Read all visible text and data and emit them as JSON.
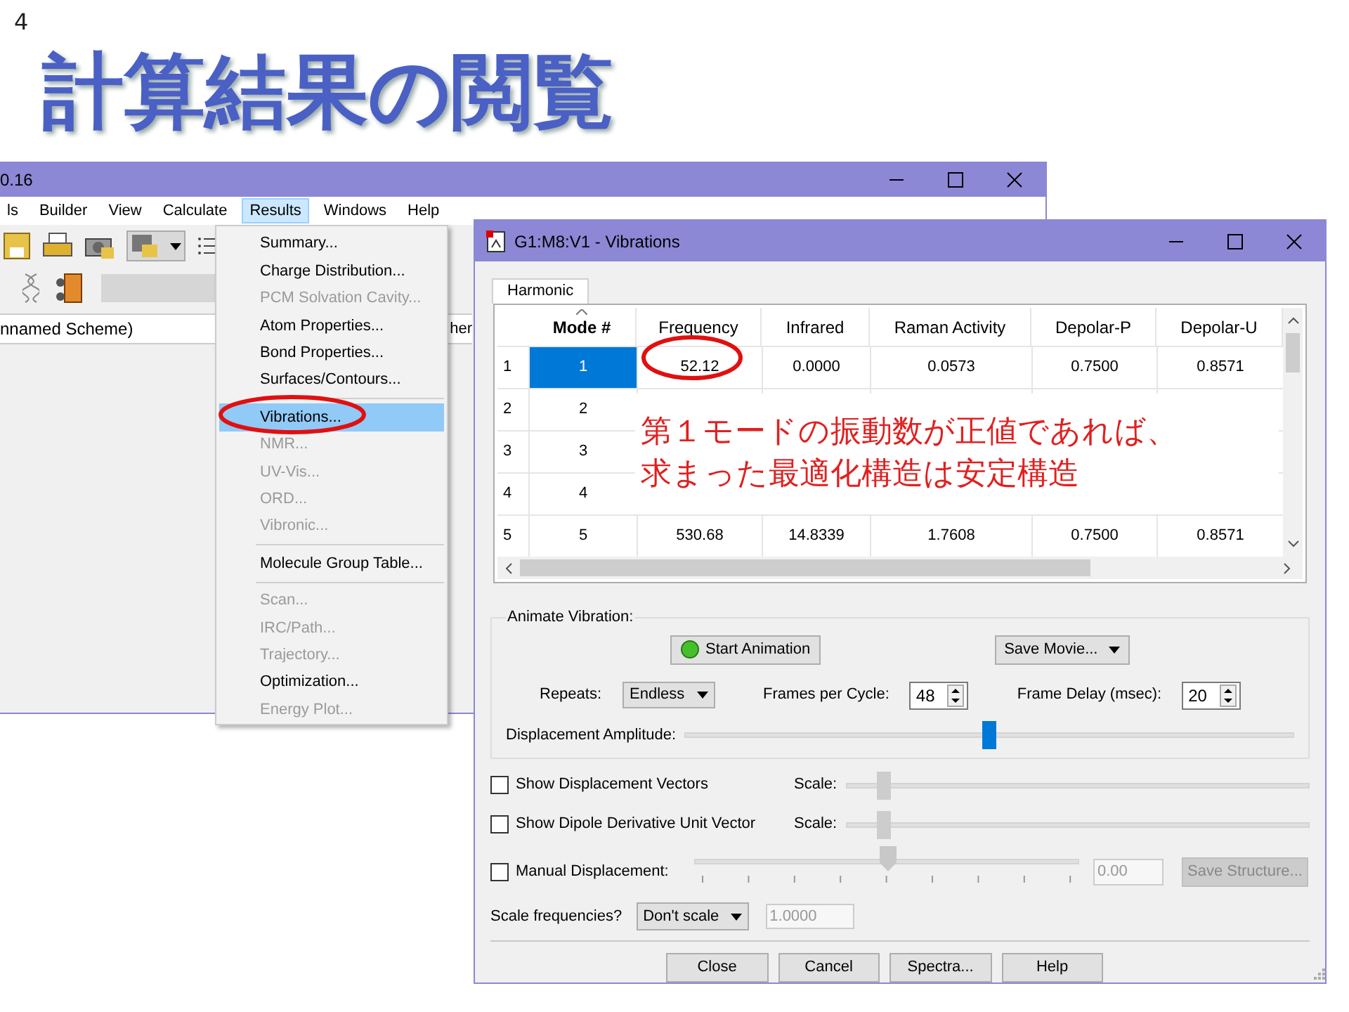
{
  "slide": {
    "page_number": "4",
    "title": "計算結果の閲覧"
  },
  "main_window": {
    "title": "0.16",
    "menu": [
      {
        "label": "ls",
        "selected": false
      },
      {
        "label": "Builder",
        "selected": false
      },
      {
        "label": "View",
        "selected": false
      },
      {
        "label": "Calculate",
        "selected": false
      },
      {
        "label": "Results",
        "selected": true
      },
      {
        "label": "Windows",
        "selected": false
      },
      {
        "label": "Help",
        "selected": false
      }
    ],
    "scheme_label": "nnamed Scheme)",
    "peek_text": "her"
  },
  "results_menu": [
    {
      "label": "Summary...",
      "disabled": false,
      "selected": false,
      "separator_before": false
    },
    {
      "label": "Charge Distribution...",
      "disabled": false,
      "selected": false,
      "separator_before": false
    },
    {
      "label": "PCM Solvation Cavity...",
      "disabled": true,
      "selected": false,
      "separator_before": false
    },
    {
      "label": "Atom Properties...",
      "disabled": false,
      "selected": false,
      "separator_before": false
    },
    {
      "label": "Bond Properties...",
      "disabled": false,
      "selected": false,
      "separator_before": false
    },
    {
      "label": "Surfaces/Contours...",
      "disabled": false,
      "selected": false,
      "separator_before": false
    },
    {
      "label": "Vibrations...",
      "disabled": false,
      "selected": true,
      "separator_before": true
    },
    {
      "label": "NMR...",
      "disabled": true,
      "selected": false,
      "separator_before": false
    },
    {
      "label": "UV-Vis...",
      "disabled": true,
      "selected": false,
      "separator_before": false
    },
    {
      "label": "ORD...",
      "disabled": true,
      "selected": false,
      "separator_before": false
    },
    {
      "label": "Vibronic...",
      "disabled": true,
      "selected": false,
      "separator_before": false
    },
    {
      "label": "Molecule Group Table...",
      "disabled": false,
      "selected": false,
      "separator_before": true
    },
    {
      "label": "Scan...",
      "disabled": true,
      "selected": false,
      "separator_before": true
    },
    {
      "label": "IRC/Path...",
      "disabled": true,
      "selected": false,
      "separator_before": false
    },
    {
      "label": "Trajectory...",
      "disabled": true,
      "selected": false,
      "separator_before": false
    },
    {
      "label": "Optimization...",
      "disabled": false,
      "selected": false,
      "separator_before": false
    },
    {
      "label": "Energy Plot...",
      "disabled": true,
      "selected": false,
      "separator_before": false
    }
  ],
  "dialog": {
    "title": "G1:M8:V1 - Vibrations",
    "tabs": [
      {
        "label": "Harmonic",
        "selected": true
      }
    ],
    "table": {
      "columns": [
        "Mode #",
        "Frequency",
        "Infrared",
        "Raman Activity",
        "Depolar-P",
        "Depolar-U"
      ],
      "rows": [
        {
          "header": "1",
          "selected": true,
          "cells": [
            "1",
            "52.12",
            "0.0000",
            "0.0573",
            "0.7500",
            "0.8571"
          ]
        },
        {
          "header": "2",
          "selected": false,
          "cells": [
            "2"
          ]
        },
        {
          "header": "3",
          "selected": false,
          "cells": [
            "3"
          ]
        },
        {
          "header": "4",
          "selected": false,
          "cells": [
            "4"
          ]
        },
        {
          "header": "5",
          "selected": false,
          "cells": [
            "5",
            "530.68",
            "14.8339",
            "1.7608",
            "0.7500",
            "0.8571"
          ]
        }
      ]
    },
    "annotation": [
      "第１モードの振動数が正値であれば、",
      "求まった最適化構造は安定構造"
    ],
    "animate": {
      "group_label": "Animate Vibration:",
      "start_button": "Start Animation",
      "save_movie": "Save Movie...",
      "repeats_label": "Repeats:",
      "repeats_value": "Endless",
      "frames_label": "Frames per Cycle:",
      "frames_value": "48",
      "delay_label": "Frame Delay (msec):",
      "delay_value": "20",
      "amplitude_label": "Displacement Amplitude:",
      "amplitude": {
        "level": 0.5
      }
    },
    "options": [
      {
        "kind": "scale",
        "label": "Show Displacement Vectors",
        "checked": false,
        "scale_label": "Scale:",
        "level": 0.08
      },
      {
        "kind": "scale",
        "label": "Show Dipole Derivative Unit Vector",
        "checked": false,
        "scale_label": "Scale:",
        "level": 0.08
      },
      {
        "kind": "manual",
        "label": "Manual Displacement:",
        "checked": false,
        "level": 0.5,
        "value": "0.00",
        "button": "Save Structure..."
      }
    ],
    "scale_frequencies": {
      "label": "Scale frequencies?",
      "value": "Don't scale",
      "factor": "1.0000"
    },
    "buttons": [
      "Close",
      "Cancel",
      "Spectra...",
      "Help"
    ]
  }
}
